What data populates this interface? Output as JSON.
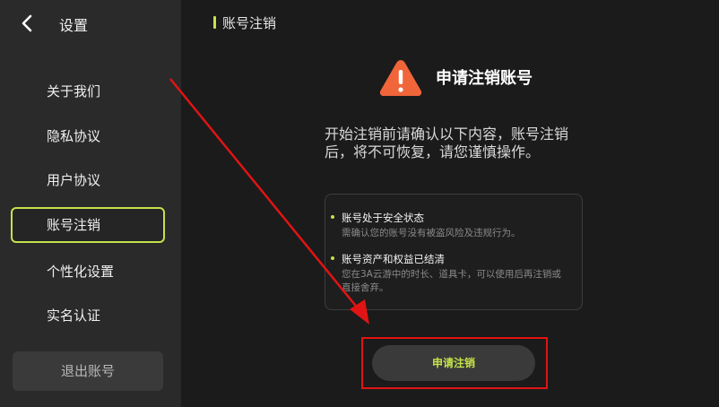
{
  "sidebar": {
    "title": "设置",
    "items": [
      {
        "label": "关于我们"
      },
      {
        "label": "隐私协议"
      },
      {
        "label": "用户协议"
      },
      {
        "label": "账号注销"
      },
      {
        "label": "个性化设置"
      },
      {
        "label": "实名认证"
      }
    ],
    "logout_label": "退出账号"
  },
  "main": {
    "header_title": "账号注销",
    "page_title": "申请注销账号",
    "notice": "开始注销前请确认以下内容，账号注销后，将不可恢复，请您谨慎操作。",
    "conditions": [
      {
        "title": "账号处于安全状态",
        "desc": "需确认您的账号没有被盗风险及违规行为。"
      },
      {
        "title": "账号资产和权益已结清",
        "desc": "您在3A云游中的时长、道具卡，可以使用后再注销或直接舍弃。"
      }
    ],
    "apply_button": "申请注销"
  },
  "colors": {
    "accent": "#c4e24a",
    "warning": "#f0653a",
    "annotation": "#e01414"
  }
}
